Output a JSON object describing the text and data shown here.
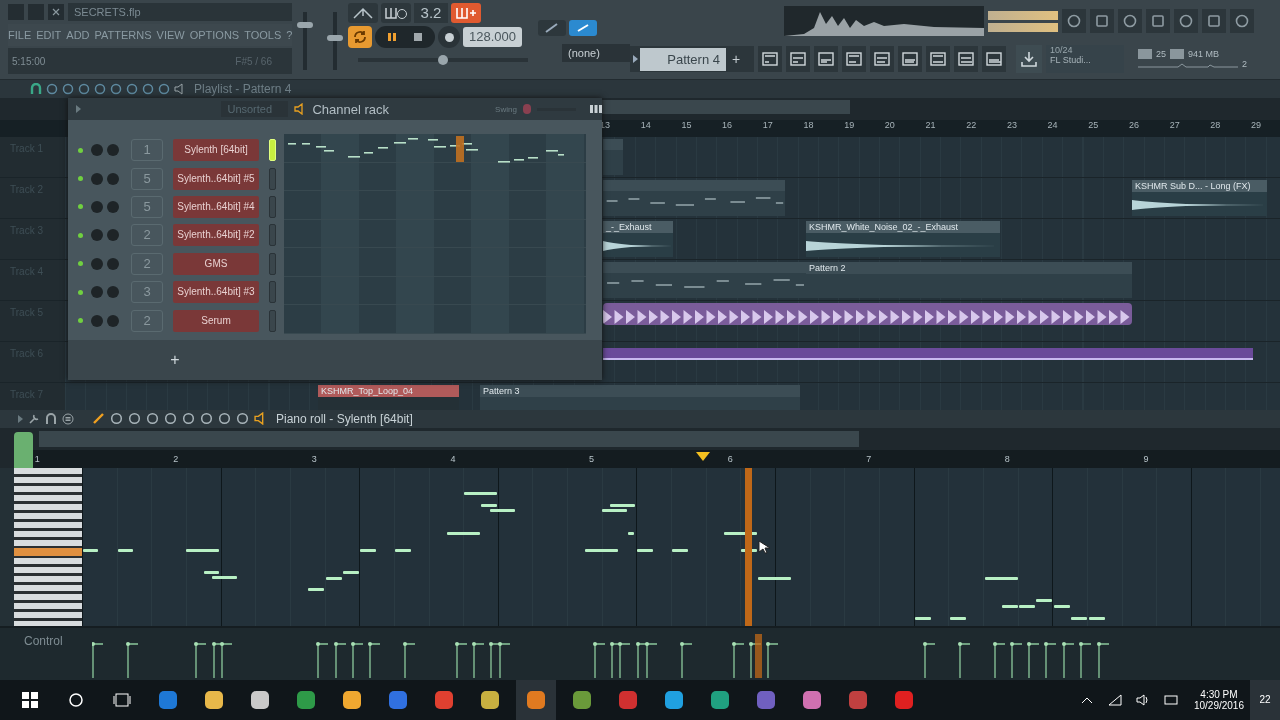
{
  "title_bar": {
    "file": "SECRETS.flp"
  },
  "menu": [
    "FILE",
    "EDIT",
    "ADD",
    "PATTERNS",
    "VIEW",
    "OPTIONS",
    "TOOLS",
    "?"
  ],
  "hint_bar": {
    "time": "5:15:00",
    "note": "F#5 / 66"
  },
  "sliders": [
    {
      "level": 0.8
    },
    {
      "level": 0.55
    }
  ],
  "transport": {
    "beat_display": "3.2",
    "tempo": "128.000",
    "snap": "(none)",
    "playing": true,
    "pitch": {
      "level": 0.5
    }
  },
  "pattern_selector": {
    "pattern": "Pattern 4",
    "add": "+"
  },
  "news": {
    "date": "10/24",
    "text": "FL Studi..."
  },
  "resources": {
    "cpu": "25",
    "memory": "941 MB",
    "polyphony": "2"
  },
  "playlist": {
    "title": "Playlist - Pattern 4",
    "ruler": [
      "13",
      "14",
      "15",
      "16",
      "17",
      "18",
      "19",
      "20",
      "21",
      "22",
      "23",
      "24",
      "25",
      "26",
      "27",
      "28",
      "29"
    ],
    "tracks": [
      {
        "name": "Track 1",
        "clips": [
          {
            "kind": "pattern"
          }
        ]
      },
      {
        "name": "Track 2",
        "clips": [
          {
            "kind": "pattern"
          },
          {
            "kind": "audio",
            "label": "KSHMR Sub D... - Long (FX)"
          }
        ]
      },
      {
        "name": "Track 3",
        "clips": [
          {
            "kind": "audio",
            "label": "_-_Exhaust"
          },
          {
            "kind": "audio",
            "label": "KSHMR_White_Noise_02_-_Exhaust"
          }
        ]
      },
      {
        "name": "Track 4",
        "clips": [
          {
            "kind": "pattern"
          },
          {
            "kind": "pattern",
            "label": "Pattern 2"
          }
        ]
      },
      {
        "name": "Track 5",
        "clips": [
          {
            "kind": "loop"
          }
        ]
      },
      {
        "name": "Track 6",
        "clips": [
          {
            "kind": "bar"
          }
        ]
      },
      {
        "name": "Track 7",
        "clips": [
          {
            "kind": "sample",
            "label": "KSHMR_Top_Loop_04"
          },
          {
            "kind": "pattern",
            "label": "Pattern 3"
          }
        ]
      }
    ]
  },
  "channel_rack": {
    "title": "Channel rack",
    "filter": "Unsorted",
    "swing": "Swing",
    "add": "+",
    "channels": [
      {
        "route": "1",
        "name": "Sylenth  [64bit]",
        "selected": true
      },
      {
        "route": "5",
        "name": "Sylenth..64bit] #5",
        "selected": false
      },
      {
        "route": "5",
        "name": "Sylenth..64bit] #4",
        "selected": false
      },
      {
        "route": "2",
        "name": "Sylenth..64bit] #2",
        "selected": false
      },
      {
        "route": "2",
        "name": "GMS",
        "selected": false
      },
      {
        "route": "3",
        "name": "Sylenth..64bit] #3",
        "selected": false
      },
      {
        "route": "2",
        "name": "Serum",
        "selected": false
      }
    ]
  },
  "piano_roll": {
    "title": "Piano roll - Sylenth  [64bit]",
    "bars": [
      "1",
      "2",
      "3",
      "4",
      "5",
      "6",
      "7",
      "8",
      "9"
    ],
    "control": "Control"
  },
  "taskbar": {
    "time": "4:30 PM",
    "date": "10/29/2016",
    "notifications": "22"
  }
}
